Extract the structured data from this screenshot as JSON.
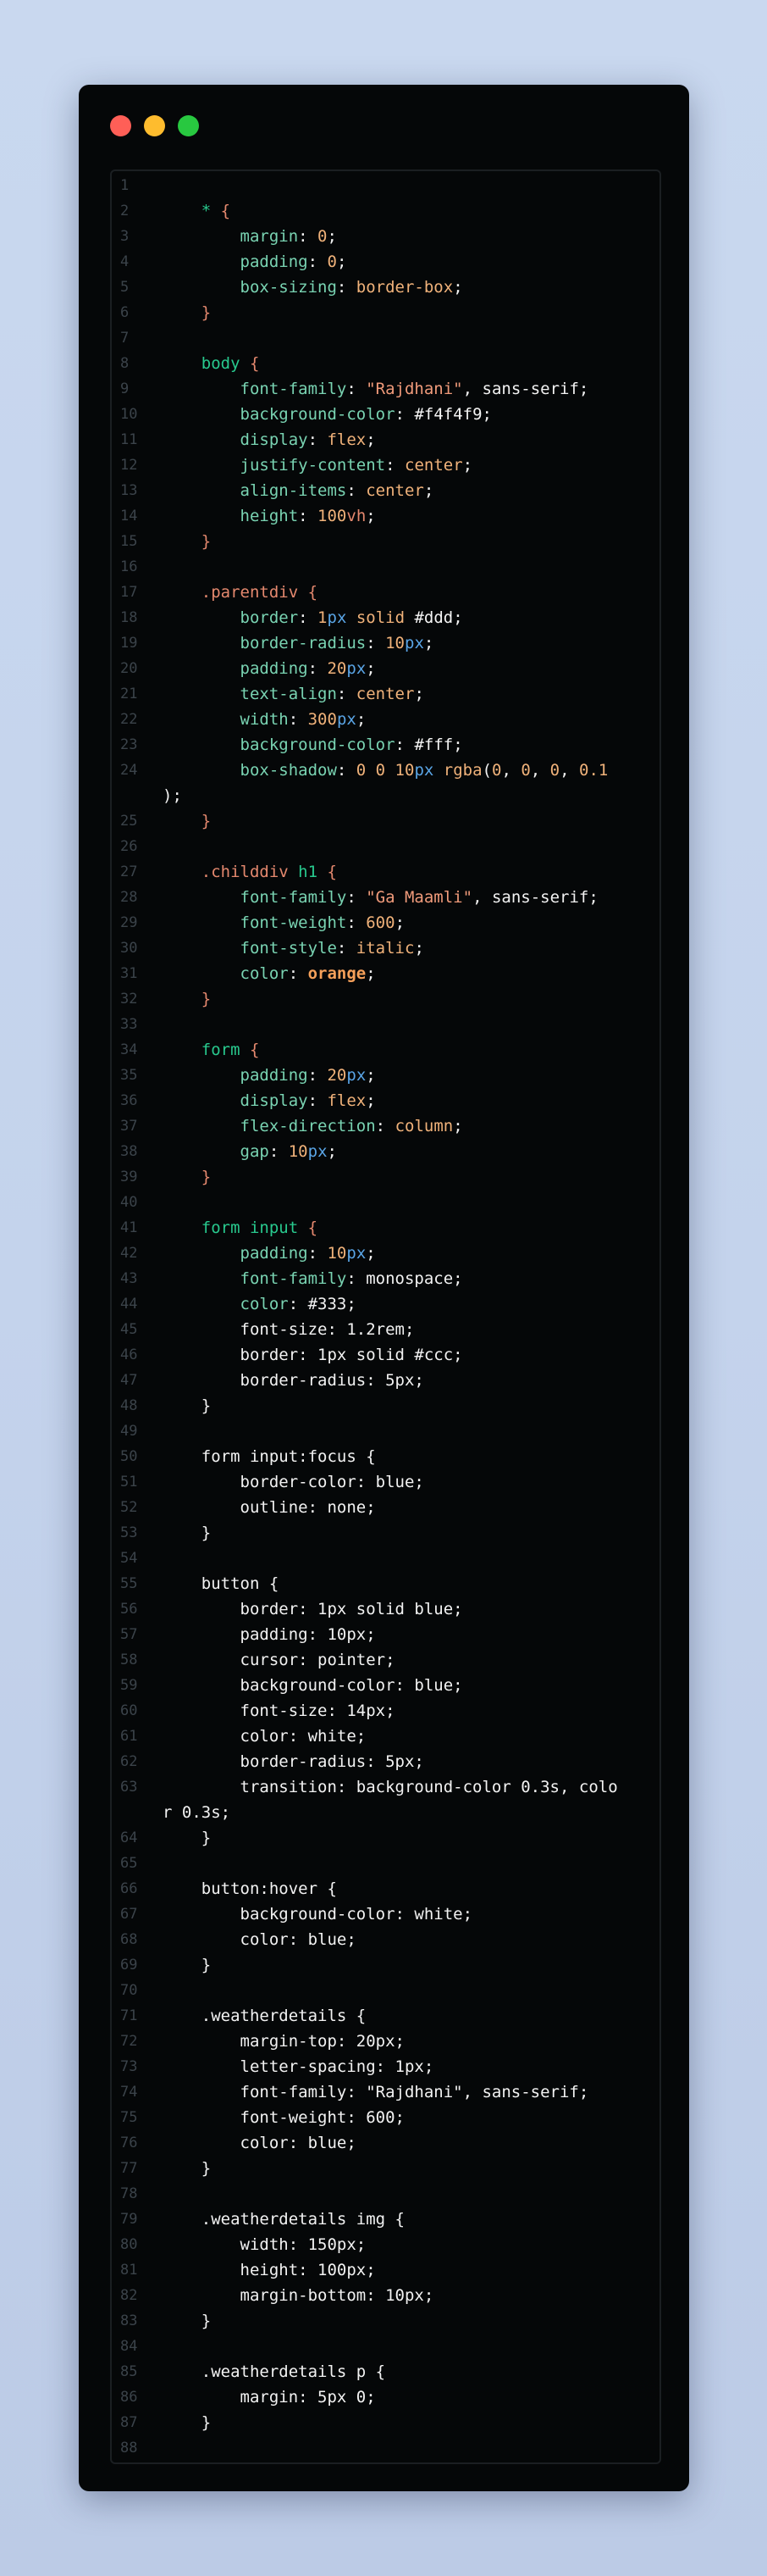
{
  "lines": [
    {
      "n": "1",
      "parts": []
    },
    {
      "n": "2",
      "parts": [
        [
          "sel",
          "    * "
        ],
        [
          "brace",
          "{"
        ]
      ]
    },
    {
      "n": "3",
      "parts": [
        [
          "prop",
          "        margin"
        ],
        [
          "plain",
          ": "
        ],
        [
          "num",
          "0"
        ],
        [
          "plain",
          ";"
        ]
      ]
    },
    {
      "n": "4",
      "parts": [
        [
          "prop",
          "        padding"
        ],
        [
          "plain",
          ": "
        ],
        [
          "num",
          "0"
        ],
        [
          "plain",
          ";"
        ]
      ]
    },
    {
      "n": "5",
      "parts": [
        [
          "prop",
          "        box-sizing"
        ],
        [
          "plain",
          ": "
        ],
        [
          "val",
          "border-box"
        ],
        [
          "plain",
          ";"
        ]
      ]
    },
    {
      "n": "6",
      "parts": [
        [
          "brace",
          "    }"
        ]
      ]
    },
    {
      "n": "7",
      "parts": []
    },
    {
      "n": "8",
      "parts": [
        [
          "sel",
          "    body "
        ],
        [
          "brace",
          "{"
        ]
      ]
    },
    {
      "n": "9",
      "parts": [
        [
          "prop",
          "        font-family"
        ],
        [
          "plain",
          ": "
        ],
        [
          "str",
          "\"Rajdhani\""
        ],
        [
          "plain",
          ", sans-serif;"
        ]
      ]
    },
    {
      "n": "10",
      "parts": [
        [
          "prop",
          "        background-color"
        ],
        [
          "plain",
          ": "
        ],
        [
          "hex",
          "#f4f4f9"
        ],
        [
          "plain",
          ";"
        ]
      ]
    },
    {
      "n": "11",
      "parts": [
        [
          "prop",
          "        display"
        ],
        [
          "plain",
          ": "
        ],
        [
          "val",
          "flex"
        ],
        [
          "plain",
          ";"
        ]
      ]
    },
    {
      "n": "12",
      "parts": [
        [
          "prop",
          "        justify-content"
        ],
        [
          "plain",
          ": "
        ],
        [
          "val",
          "center"
        ],
        [
          "plain",
          ";"
        ]
      ]
    },
    {
      "n": "13",
      "parts": [
        [
          "prop",
          "        align-items"
        ],
        [
          "plain",
          ": "
        ],
        [
          "val",
          "center"
        ],
        [
          "plain",
          ";"
        ]
      ]
    },
    {
      "n": "14",
      "parts": [
        [
          "prop",
          "        height"
        ],
        [
          "plain",
          ": "
        ],
        [
          "num",
          "100"
        ],
        [
          "cls",
          "vh"
        ],
        [
          "plain",
          ";"
        ]
      ]
    },
    {
      "n": "15",
      "parts": [
        [
          "brace",
          "    }"
        ]
      ]
    },
    {
      "n": "16",
      "parts": []
    },
    {
      "n": "17",
      "parts": [
        [
          "cls",
          "    .parentdiv "
        ],
        [
          "brace",
          "{"
        ]
      ]
    },
    {
      "n": "18",
      "parts": [
        [
          "prop",
          "        border"
        ],
        [
          "plain",
          ": "
        ],
        [
          "num",
          "1"
        ],
        [
          "unit",
          "px"
        ],
        [
          "val",
          " solid "
        ],
        [
          "hex",
          "#ddd"
        ],
        [
          "plain",
          ";"
        ]
      ]
    },
    {
      "n": "19",
      "parts": [
        [
          "prop",
          "        border-radius"
        ],
        [
          "plain",
          ": "
        ],
        [
          "num",
          "10"
        ],
        [
          "unit",
          "px"
        ],
        [
          "plain",
          ";"
        ]
      ]
    },
    {
      "n": "20",
      "parts": [
        [
          "prop",
          "        padding"
        ],
        [
          "plain",
          ": "
        ],
        [
          "num",
          "20"
        ],
        [
          "unit",
          "px"
        ],
        [
          "plain",
          ";"
        ]
      ]
    },
    {
      "n": "21",
      "parts": [
        [
          "prop",
          "        text-align"
        ],
        [
          "plain",
          ": "
        ],
        [
          "val",
          "center"
        ],
        [
          "plain",
          ";"
        ]
      ]
    },
    {
      "n": "22",
      "parts": [
        [
          "prop",
          "        width"
        ],
        [
          "plain",
          ": "
        ],
        [
          "num",
          "300"
        ],
        [
          "unit",
          "px"
        ],
        [
          "plain",
          ";"
        ]
      ]
    },
    {
      "n": "23",
      "parts": [
        [
          "prop",
          "        background-color"
        ],
        [
          "plain",
          ": "
        ],
        [
          "hex",
          "#fff"
        ],
        [
          "plain",
          ";"
        ]
      ]
    },
    {
      "n": "24",
      "parts": [
        [
          "prop",
          "        box-shadow"
        ],
        [
          "plain",
          ": "
        ],
        [
          "num",
          "0 0 10"
        ],
        [
          "unit",
          "px"
        ],
        [
          "val",
          " rgba"
        ],
        [
          "plain",
          "("
        ],
        [
          "num",
          "0"
        ],
        [
          "plain",
          ", "
        ],
        [
          "num",
          "0"
        ],
        [
          "plain",
          ", "
        ],
        [
          "num",
          "0"
        ],
        [
          "plain",
          ", "
        ],
        [
          "num",
          "0.1"
        ]
      ]
    },
    {
      "n": "",
      "parts": [
        [
          "plain",
          ");"
        ]
      ]
    },
    {
      "n": "25",
      "parts": [
        [
          "brace",
          "    }"
        ]
      ]
    },
    {
      "n": "26",
      "parts": []
    },
    {
      "n": "27",
      "parts": [
        [
          "cls",
          "    .childdiv "
        ],
        [
          "sel",
          "h1 "
        ],
        [
          "brace",
          "{"
        ]
      ]
    },
    {
      "n": "28",
      "parts": [
        [
          "prop",
          "        font-family"
        ],
        [
          "plain",
          ": "
        ],
        [
          "str",
          "\"Ga Maamli\""
        ],
        [
          "plain",
          ", sans-serif;"
        ]
      ]
    },
    {
      "n": "29",
      "parts": [
        [
          "prop",
          "        font-weight"
        ],
        [
          "plain",
          ": "
        ],
        [
          "num",
          "600"
        ],
        [
          "plain",
          ";"
        ]
      ]
    },
    {
      "n": "30",
      "parts": [
        [
          "prop",
          "        font-style"
        ],
        [
          "plain",
          ": "
        ],
        [
          "val",
          "italic"
        ],
        [
          "plain",
          ";"
        ]
      ]
    },
    {
      "n": "31",
      "parts": [
        [
          "prop",
          "        color"
        ],
        [
          "plain",
          ": "
        ],
        [
          "orange",
          "orange"
        ],
        [
          "plain",
          ";"
        ]
      ]
    },
    {
      "n": "32",
      "parts": [
        [
          "brace",
          "    }"
        ]
      ]
    },
    {
      "n": "33",
      "parts": []
    },
    {
      "n": "34",
      "parts": [
        [
          "sel",
          "    form "
        ],
        [
          "brace",
          "{"
        ]
      ]
    },
    {
      "n": "35",
      "parts": [
        [
          "prop",
          "        padding"
        ],
        [
          "plain",
          ": "
        ],
        [
          "num",
          "20"
        ],
        [
          "unit",
          "px"
        ],
        [
          "plain",
          ";"
        ]
      ]
    },
    {
      "n": "36",
      "parts": [
        [
          "prop",
          "        display"
        ],
        [
          "plain",
          ": "
        ],
        [
          "val",
          "flex"
        ],
        [
          "plain",
          ";"
        ]
      ]
    },
    {
      "n": "37",
      "parts": [
        [
          "prop",
          "        flex-direction"
        ],
        [
          "plain",
          ": "
        ],
        [
          "val",
          "column"
        ],
        [
          "plain",
          ";"
        ]
      ]
    },
    {
      "n": "38",
      "parts": [
        [
          "prop",
          "        gap"
        ],
        [
          "plain",
          ": "
        ],
        [
          "num",
          "10"
        ],
        [
          "unit",
          "px"
        ],
        [
          "plain",
          ";"
        ]
      ]
    },
    {
      "n": "39",
      "parts": [
        [
          "brace",
          "    }"
        ]
      ]
    },
    {
      "n": "40",
      "parts": []
    },
    {
      "n": "41",
      "parts": [
        [
          "sel",
          "    form input "
        ],
        [
          "brace",
          "{"
        ]
      ]
    },
    {
      "n": "42",
      "parts": [
        [
          "prop",
          "        padding"
        ],
        [
          "plain",
          ": "
        ],
        [
          "num",
          "10"
        ],
        [
          "unit",
          "px"
        ],
        [
          "plain",
          ";"
        ]
      ]
    },
    {
      "n": "43",
      "parts": [
        [
          "prop",
          "        font-family"
        ],
        [
          "plain",
          ": monospace;"
        ]
      ]
    },
    {
      "n": "44",
      "parts": [
        [
          "prop",
          "        color"
        ],
        [
          "plain",
          ": #333;"
        ]
      ]
    },
    {
      "n": "45",
      "parts": [
        [
          "plain",
          "        font-size: 1.2rem;"
        ]
      ]
    },
    {
      "n": "46",
      "parts": [
        [
          "plain",
          "        border: 1px solid #ccc;"
        ]
      ]
    },
    {
      "n": "47",
      "parts": [
        [
          "plain",
          "        border-radius: 5px;"
        ]
      ]
    },
    {
      "n": "48",
      "parts": [
        [
          "plain",
          "    }"
        ]
      ]
    },
    {
      "n": "49",
      "parts": []
    },
    {
      "n": "50",
      "parts": [
        [
          "plain",
          "    form input:focus {"
        ]
      ]
    },
    {
      "n": "51",
      "parts": [
        [
          "plain",
          "        border-color: blue;"
        ]
      ]
    },
    {
      "n": "52",
      "parts": [
        [
          "plain",
          "        outline: none;"
        ]
      ]
    },
    {
      "n": "53",
      "parts": [
        [
          "plain",
          "    }"
        ]
      ]
    },
    {
      "n": "54",
      "parts": []
    },
    {
      "n": "55",
      "parts": [
        [
          "plain",
          "    button {"
        ]
      ]
    },
    {
      "n": "56",
      "parts": [
        [
          "plain",
          "        border: 1px solid blue;"
        ]
      ]
    },
    {
      "n": "57",
      "parts": [
        [
          "plain",
          "        padding: 10px;"
        ]
      ]
    },
    {
      "n": "58",
      "parts": [
        [
          "plain",
          "        cursor: pointer;"
        ]
      ]
    },
    {
      "n": "59",
      "parts": [
        [
          "plain",
          "        background-color: blue;"
        ]
      ]
    },
    {
      "n": "60",
      "parts": [
        [
          "plain",
          "        font-size: 14px;"
        ]
      ]
    },
    {
      "n": "61",
      "parts": [
        [
          "plain",
          "        color: white;"
        ]
      ]
    },
    {
      "n": "62",
      "parts": [
        [
          "plain",
          "        border-radius: 5px;"
        ]
      ]
    },
    {
      "n": "63",
      "parts": [
        [
          "plain",
          "        transition: background-color 0.3s, colo"
        ]
      ]
    },
    {
      "n": "",
      "parts": [
        [
          "plain",
          "r 0.3s;"
        ]
      ]
    },
    {
      "n": "64",
      "parts": [
        [
          "plain",
          "    }"
        ]
      ]
    },
    {
      "n": "65",
      "parts": []
    },
    {
      "n": "66",
      "parts": [
        [
          "plain",
          "    button:hover {"
        ]
      ]
    },
    {
      "n": "67",
      "parts": [
        [
          "plain",
          "        background-color: white;"
        ]
      ]
    },
    {
      "n": "68",
      "parts": [
        [
          "plain",
          "        color: blue;"
        ]
      ]
    },
    {
      "n": "69",
      "parts": [
        [
          "plain",
          "    }"
        ]
      ]
    },
    {
      "n": "70",
      "parts": []
    },
    {
      "n": "71",
      "parts": [
        [
          "plain",
          "    .weatherdetails {"
        ]
      ]
    },
    {
      "n": "72",
      "parts": [
        [
          "plain",
          "        margin-top: 20px;"
        ]
      ]
    },
    {
      "n": "73",
      "parts": [
        [
          "plain",
          "        letter-spacing: 1px;"
        ]
      ]
    },
    {
      "n": "74",
      "parts": [
        [
          "plain",
          "        font-family: \"Rajdhani\", sans-serif;"
        ]
      ]
    },
    {
      "n": "75",
      "parts": [
        [
          "plain",
          "        font-weight: 600;"
        ]
      ]
    },
    {
      "n": "76",
      "parts": [
        [
          "plain",
          "        color: blue;"
        ]
      ]
    },
    {
      "n": "77",
      "parts": [
        [
          "plain",
          "    }"
        ]
      ]
    },
    {
      "n": "78",
      "parts": []
    },
    {
      "n": "79",
      "parts": [
        [
          "plain",
          "    .weatherdetails img {"
        ]
      ]
    },
    {
      "n": "80",
      "parts": [
        [
          "plain",
          "        width: 150px;"
        ]
      ]
    },
    {
      "n": "81",
      "parts": [
        [
          "plain",
          "        height: 100px;"
        ]
      ]
    },
    {
      "n": "82",
      "parts": [
        [
          "plain",
          "        margin-bottom: 10px;"
        ]
      ]
    },
    {
      "n": "83",
      "parts": [
        [
          "plain",
          "    }"
        ]
      ]
    },
    {
      "n": "84",
      "parts": []
    },
    {
      "n": "85",
      "parts": [
        [
          "plain",
          "    .weatherdetails p {"
        ]
      ]
    },
    {
      "n": "86",
      "parts": [
        [
          "plain",
          "        margin: 5px 0;"
        ]
      ]
    },
    {
      "n": "87",
      "parts": [
        [
          "plain",
          "    }"
        ]
      ]
    },
    {
      "n": "88",
      "parts": []
    }
  ]
}
